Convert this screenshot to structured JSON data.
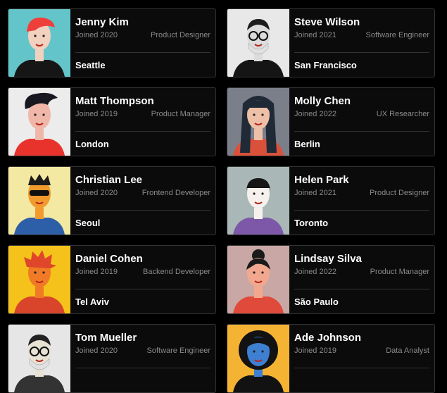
{
  "people": [
    {
      "name": "Jenny Kim",
      "joined": "Joined 2020",
      "role": "Product Designer",
      "city": "Seattle",
      "avatar": {
        "bg": "#63c5c9",
        "skin": "#f2d1bf",
        "hair": "#ef3f3b",
        "shirt": "#161616",
        "style": "red-bob"
      }
    },
    {
      "name": "Steve Wilson",
      "joined": "Joined 2021",
      "role": "Software Engineer",
      "city": "San Francisco",
      "avatar": {
        "bg": "#e8e8e8",
        "skin": "#dcdcdc",
        "hair": "#1c1c1c",
        "shirt": "#151515",
        "style": "glasses-beard"
      }
    },
    {
      "name": "Matt Thompson",
      "joined": "Joined 2019",
      "role": "Product Manager",
      "city": "London",
      "avatar": {
        "bg": "#ececec",
        "skin": "#f0b7a8",
        "hair": "#16171f",
        "shirt": "#e8332d",
        "style": "quiff"
      }
    },
    {
      "name": "Molly Chen",
      "joined": "Joined 2022",
      "role": "UX Researcher",
      "city": "Berlin",
      "avatar": {
        "bg": "#7a7f8a",
        "skin": "#eec0a8",
        "hair": "#1f2a36",
        "shirt": "#d9503b",
        "style": "long-hair"
      }
    },
    {
      "name": "Christian Lee",
      "joined": "Joined 2020",
      "role": "Frontend Developer",
      "city": "Seoul",
      "avatar": {
        "bg": "#f4e9a2",
        "skin": "#f39a2e",
        "hair": "#1c1c1c",
        "shirt": "#2c5fa8",
        "style": "sunglasses"
      }
    },
    {
      "name": "Helen Park",
      "joined": "Joined 2021",
      "role": "Product Designer",
      "city": "Toronto",
      "avatar": {
        "bg": "#a9b8b6",
        "skin": "#f6f1ec",
        "hair": "#161616",
        "shirt": "#7d58a8",
        "style": "bangs"
      }
    },
    {
      "name": "Daniel Cohen",
      "joined": "Joined 2019",
      "role": "Backend Developer",
      "city": "Tel Aviv",
      "avatar": {
        "bg": "#f5c21b",
        "skin": "#f07a26",
        "hair": "#e0462a",
        "shirt": "#d9452b",
        "style": "spiky"
      }
    },
    {
      "name": "Lindsay Silva",
      "joined": "Joined 2022",
      "role": "Product Manager",
      "city": "São Paulo",
      "avatar": {
        "bg": "#c9a7a4",
        "skin": "#f2a88e",
        "hair": "#1a1a1a",
        "shirt": "#e04a3a",
        "style": "bun"
      }
    },
    {
      "name": "Tom Mueller",
      "joined": "Joined 2020",
      "role": "Software Engineer",
      "city": "",
      "avatar": {
        "bg": "#e6e6e6",
        "skin": "#e8e2d4",
        "hair": "#222222",
        "shirt": "#333333",
        "style": "glasses-beard"
      }
    },
    {
      "name": "Ade Johnson",
      "joined": "Joined 2019",
      "role": "Data Analyst",
      "city": "",
      "avatar": {
        "bg": "#f5b334",
        "skin": "#3e7fd1",
        "hair": "#121212",
        "shirt": "#121212",
        "style": "afro"
      }
    }
  ]
}
